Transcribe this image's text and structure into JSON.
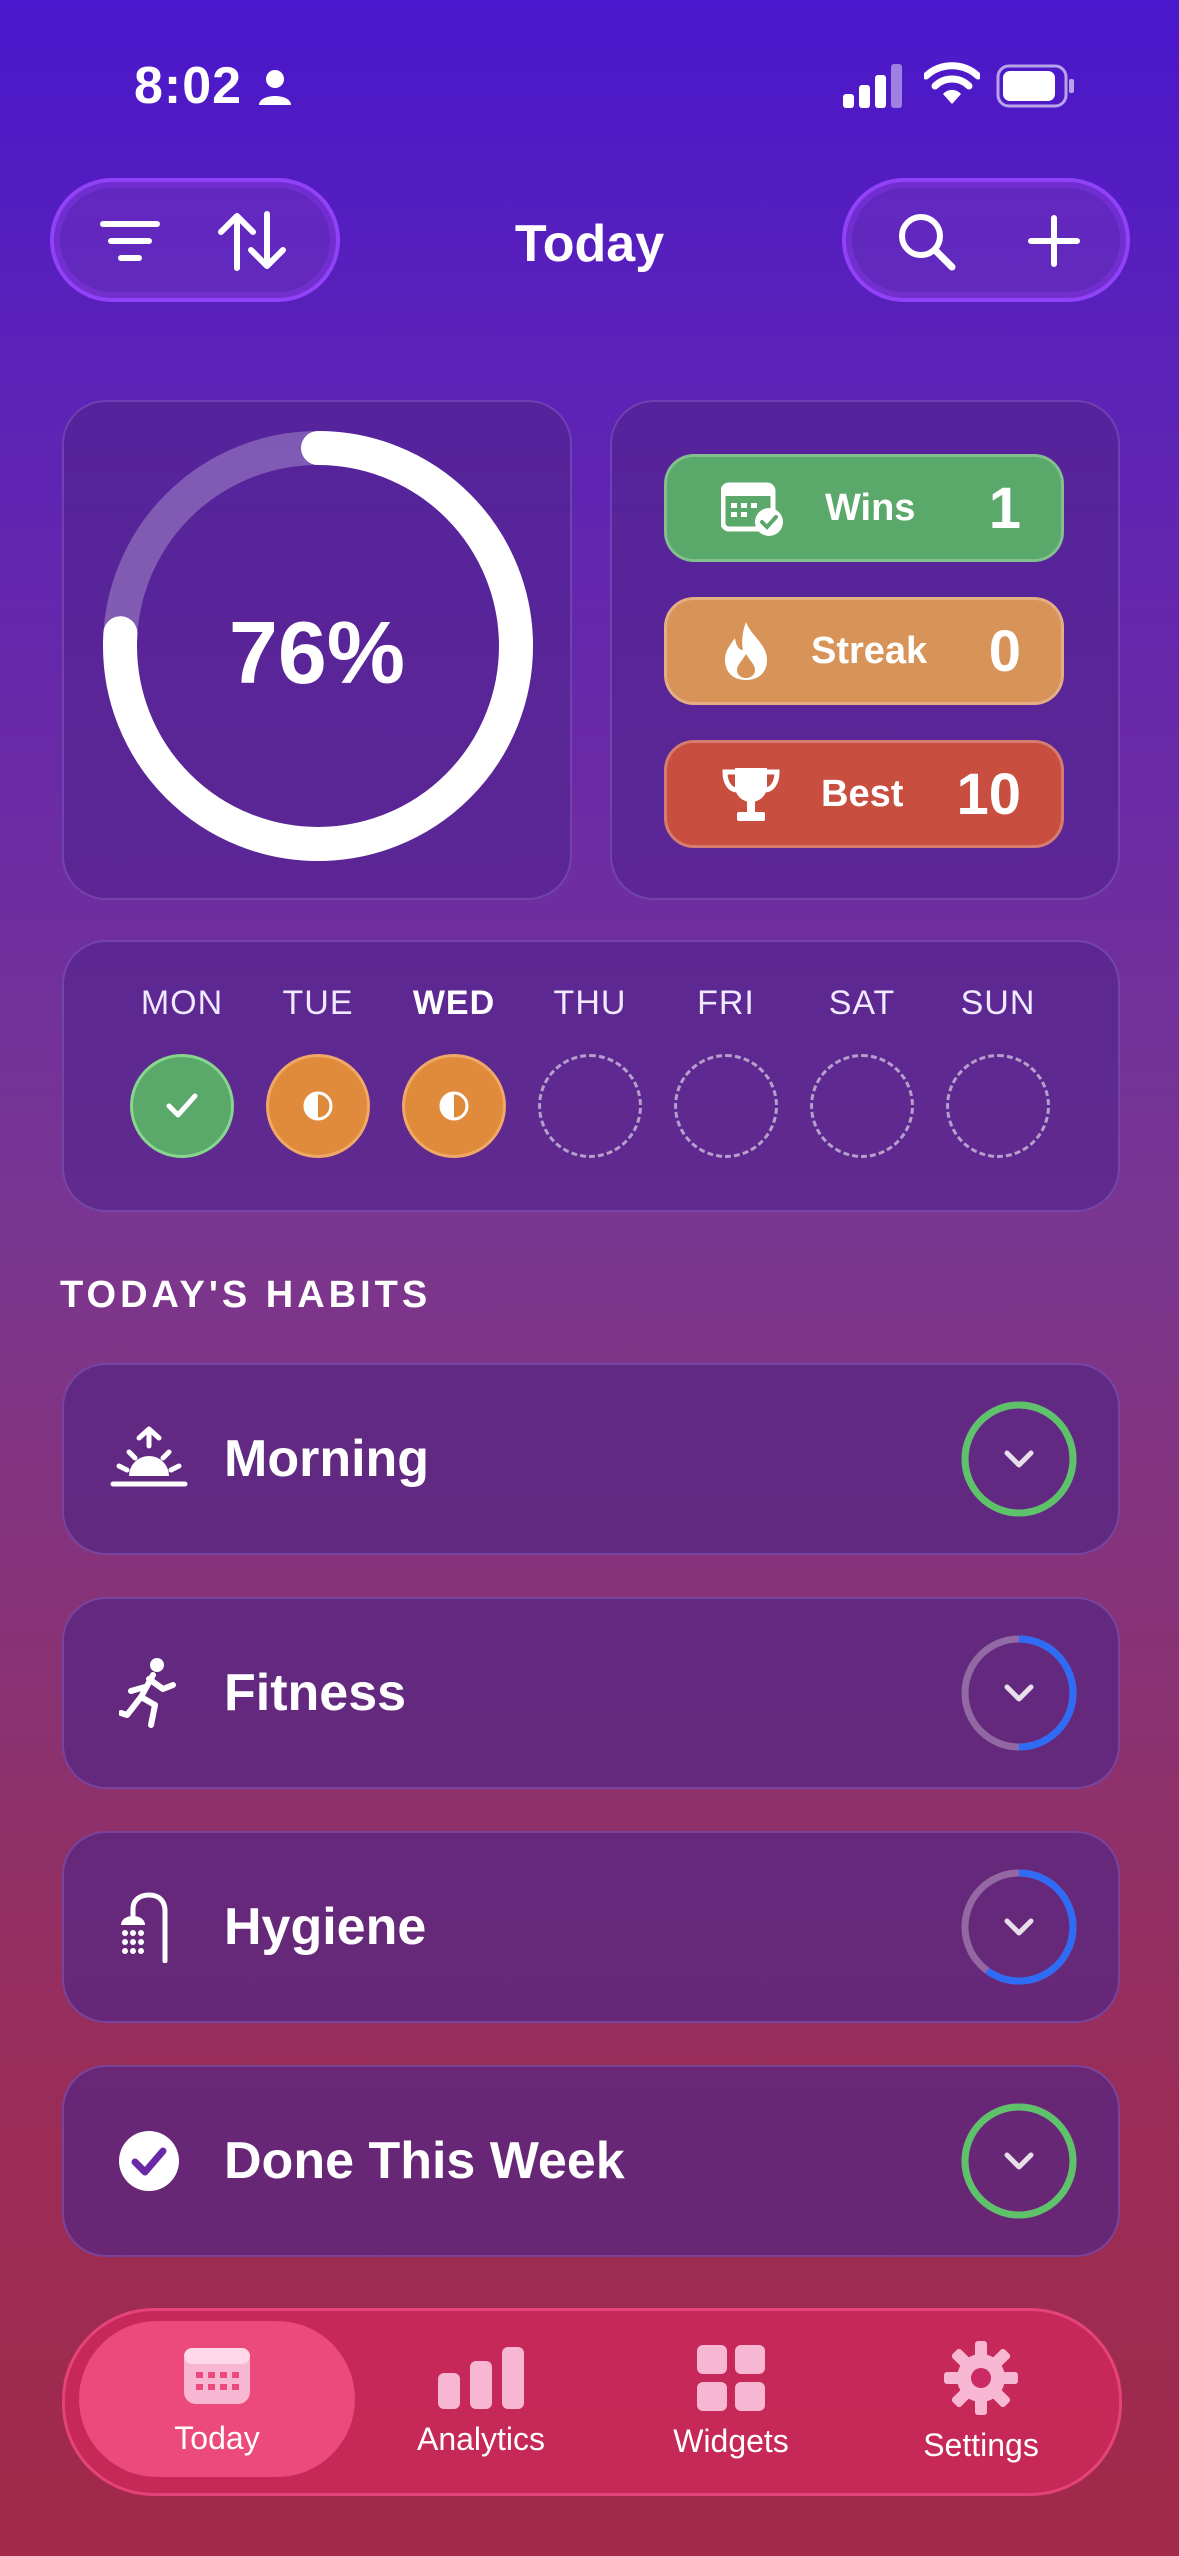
{
  "status": {
    "time": "8:02"
  },
  "header": {
    "title": "Today"
  },
  "progress": {
    "percent_label": "76%",
    "fraction": 0.76
  },
  "stats": [
    {
      "label": "Wins",
      "value": "1",
      "color": "#5aa86a",
      "icon": "calendar-check-icon"
    },
    {
      "label": "Streak",
      "value": "0",
      "color": "#d89359",
      "icon": "flame-icon"
    },
    {
      "label": "Best",
      "value": "10",
      "color": "#c84f3f",
      "icon": "trophy-icon"
    }
  ],
  "week": [
    {
      "day": "MON",
      "state": "complete"
    },
    {
      "day": "TUE",
      "state": "partial"
    },
    {
      "day": "WED",
      "state": "partial",
      "current": true
    },
    {
      "day": "THU",
      "state": "empty"
    },
    {
      "day": "FRI",
      "state": "empty"
    },
    {
      "day": "SAT",
      "state": "empty"
    },
    {
      "day": "SUN",
      "state": "empty"
    }
  ],
  "section_title": "TODAY'S HABITS",
  "habits": [
    {
      "label": "Morning",
      "icon": "sunrise-icon",
      "progress": 1.0,
      "ring_color": "#5ec26a"
    },
    {
      "label": "Fitness",
      "icon": "running-icon",
      "progress": 0.5,
      "ring_color": "#2f6cf5"
    },
    {
      "label": "Hygiene",
      "icon": "shower-icon",
      "progress": 0.6,
      "ring_color": "#2f6cf5"
    },
    {
      "label": "Done This Week",
      "icon": "checkmark-circle-icon",
      "progress": 1.0,
      "ring_color": "#5ec26a"
    }
  ],
  "tabs": [
    {
      "label": "Today",
      "icon": "calendar-icon",
      "active": true
    },
    {
      "label": "Analytics",
      "icon": "bar-chart-icon",
      "active": false
    },
    {
      "label": "Widgets",
      "icon": "widgets-grid-icon",
      "active": false
    },
    {
      "label": "Settings",
      "icon": "gear-icon",
      "active": false
    }
  ],
  "colors": {
    "complete": "#5aa86a",
    "partial": "#e08b3c",
    "accent": "#7d3cff"
  }
}
